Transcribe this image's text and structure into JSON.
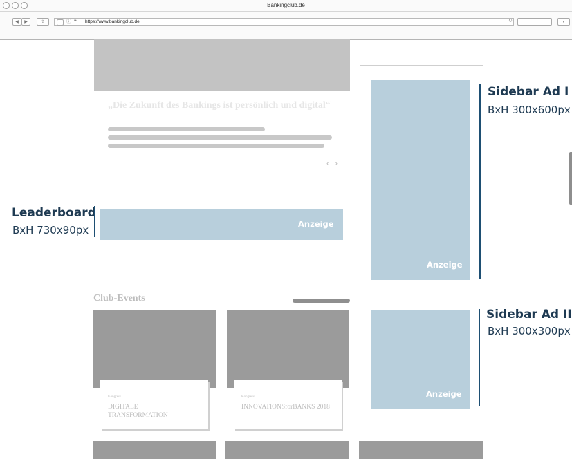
{
  "browser": {
    "title": "Bankingclub.de",
    "url": "https://www.bankingclub.de"
  },
  "article": {
    "quote": "„Die Zukunft des Bankings ist persönlich und digital“",
    "carousel_prev": "‹",
    "carousel_next": "›"
  },
  "ads": {
    "label": "Anzeige",
    "leaderboard": {
      "name": "Leaderboard",
      "size": "BxH 730x90px"
    },
    "sidebar1": {
      "name": "Sidebar Ad I",
      "size": "BxH 300x600px"
    },
    "sidebar2": {
      "name": "Sidebar Ad II",
      "size": "BxH 300x300px"
    }
  },
  "club_events": {
    "heading": "Club-Events",
    "cards": [
      {
        "kicker": "Kongress",
        "title_line1": "DIGITALE",
        "title_line2": "TRANSFORMATION"
      },
      {
        "kicker": "Kongress",
        "title_line1": "INNOVATIONSforBANKS 2018",
        "title_line2": ""
      }
    ]
  },
  "colors": {
    "ad_fill": "#b8cfdc",
    "annotation": "#1e3a52",
    "annotation_line": "#1e4f73",
    "placeholder_grey": "#c3c3c3"
  }
}
